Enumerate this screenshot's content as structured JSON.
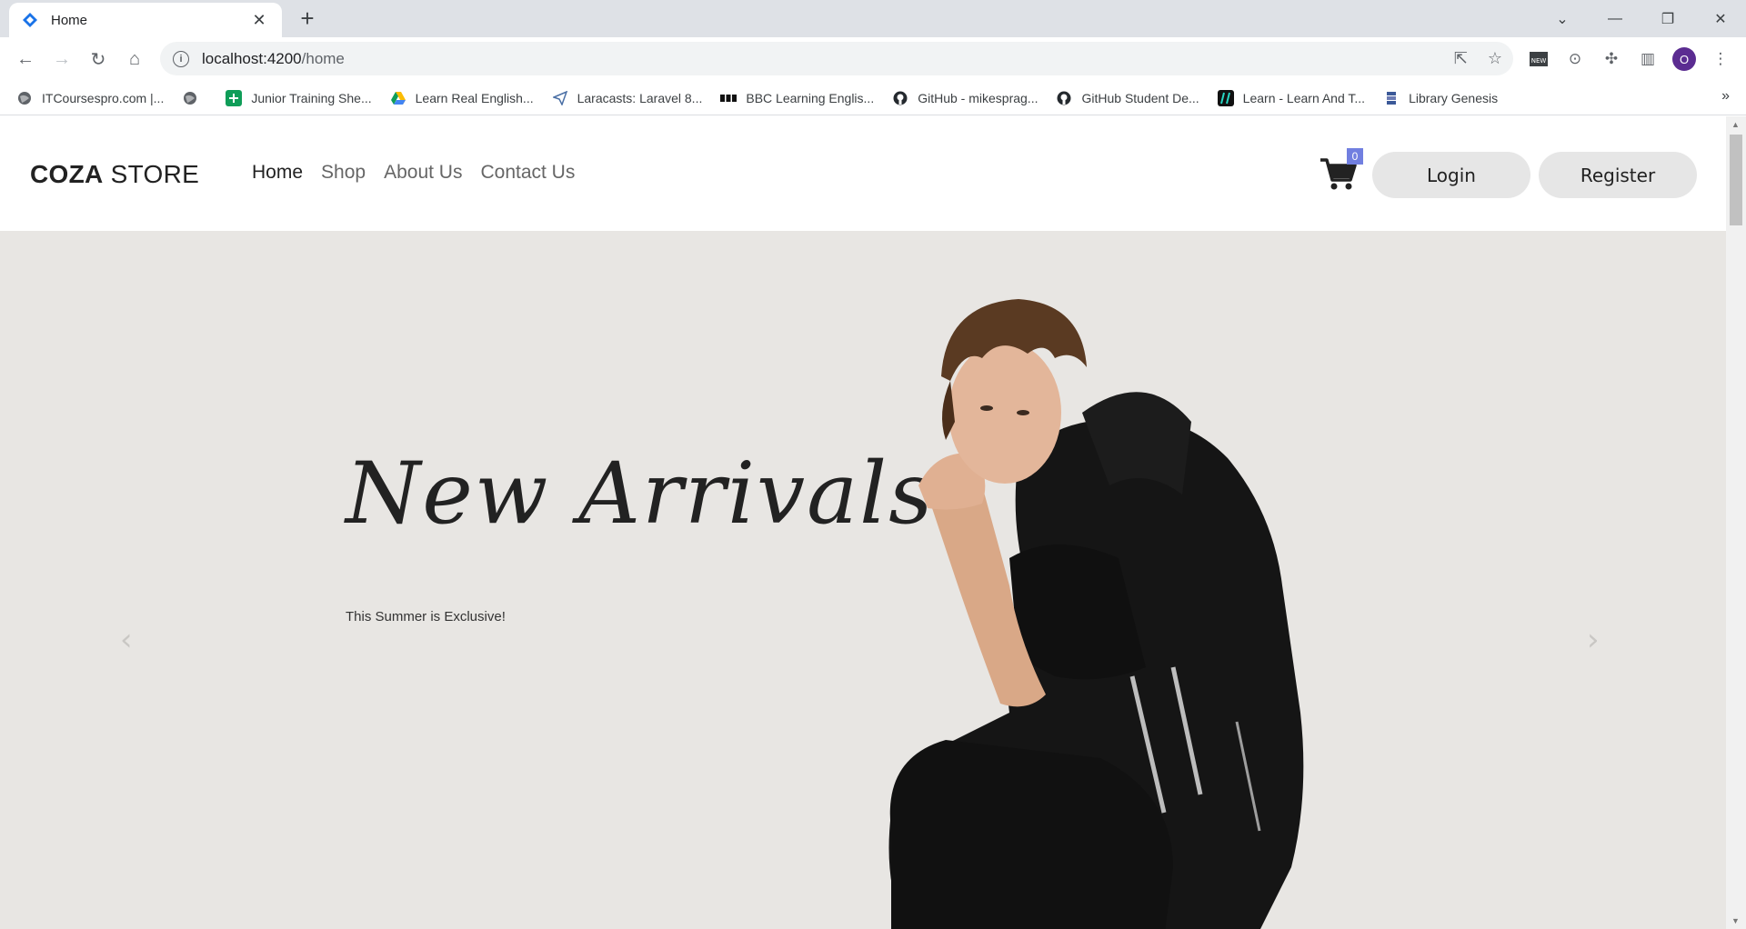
{
  "browser": {
    "tab": {
      "title": "Home"
    },
    "url": {
      "host": "localhost:4200",
      "path": "/home"
    },
    "profile_initial": "O",
    "bookmarks": [
      {
        "label": "ITCoursespro.com |...",
        "icon": "globe-icon"
      },
      {
        "label": "",
        "icon": "globe-icon"
      },
      {
        "label": "Junior Training She...",
        "icon": "sheets-icon"
      },
      {
        "label": "Learn Real English...",
        "icon": "drive-icon"
      },
      {
        "label": "Laracasts: Laravel 8...",
        "icon": "paper-plane-icon"
      },
      {
        "label": "BBC Learning Englis...",
        "icon": "bbc-icon"
      },
      {
        "label": "GitHub - mikesprag...",
        "icon": "github-icon"
      },
      {
        "label": "GitHub Student De...",
        "icon": "github-icon"
      },
      {
        "label": "Learn - Learn And T...",
        "icon": "learn-icon"
      },
      {
        "label": "Library Genesis",
        "icon": "library-icon"
      }
    ]
  },
  "site": {
    "logo": {
      "bold": "COZA",
      "regular": " STORE"
    },
    "nav": [
      {
        "label": "Home",
        "active": true
      },
      {
        "label": "Shop",
        "active": false
      },
      {
        "label": "About Us",
        "active": false
      },
      {
        "label": "Contact Us",
        "active": false
      }
    ],
    "cart_count": "0",
    "login_label": "Login",
    "register_label": "Register",
    "accent_color": "#717fe0"
  },
  "hero": {
    "title": "New Arrivals",
    "subtitle": "This Summer is Exclusive!",
    "background": "#e8e6e3"
  }
}
